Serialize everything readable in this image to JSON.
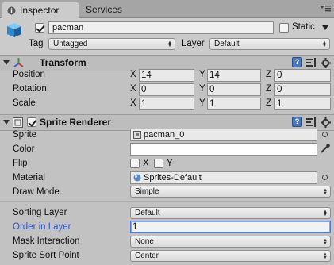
{
  "tabs": [
    {
      "label": "Inspector"
    },
    {
      "label": "Services"
    }
  ],
  "header": {
    "name": "pacman",
    "active": true,
    "static_label": "Static",
    "static_checked": false,
    "tag_label": "Tag",
    "tag_value": "Untagged",
    "layer_label": "Layer",
    "layer_value": "Default"
  },
  "transform": {
    "title": "Transform",
    "rows": [
      {
        "label": "Position",
        "x": "14",
        "y": "14",
        "z": "0"
      },
      {
        "label": "Rotation",
        "x": "0",
        "y": "0",
        "z": "0"
      },
      {
        "label": "Scale",
        "x": "1",
        "y": "1",
        "z": "1"
      }
    ],
    "axis_x": "X",
    "axis_y": "Y",
    "axis_z": "Z"
  },
  "sprite_renderer": {
    "title": "Sprite Renderer",
    "enabled": true,
    "sprite_label": "Sprite",
    "sprite_value": "pacman_0",
    "color_label": "Color",
    "color_value": "#ffffff",
    "flip_label": "Flip",
    "flip_x": "X",
    "flip_y": "Y",
    "material_label": "Material",
    "material_value": "Sprites-Default",
    "draw_mode_label": "Draw Mode",
    "draw_mode_value": "Simple",
    "sorting_layer_label": "Sorting Layer",
    "sorting_layer_value": "Default",
    "order_label": "Order in Layer",
    "order_value": "1",
    "mask_label": "Mask Interaction",
    "mask_value": "None",
    "sort_point_label": "Sprite Sort Point",
    "sort_point_value": "Center"
  },
  "colors": {
    "focused_label": "#2b57c8",
    "focused_border": "#4d7cd6",
    "panel_bg": "#c2c2c2"
  }
}
